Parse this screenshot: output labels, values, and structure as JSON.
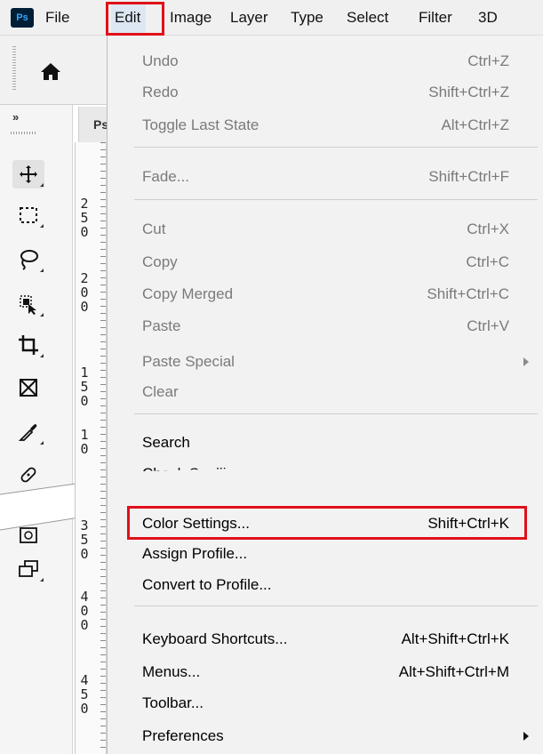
{
  "app": {
    "logo_text": "Ps"
  },
  "menubar": {
    "items": [
      "File",
      "Edit",
      "Image",
      "Layer",
      "Type",
      "Select",
      "Filter",
      "3D"
    ]
  },
  "document_tab": {
    "label": "Ps"
  },
  "toolbar": {
    "tools": [
      "home-icon",
      "move-icon",
      "marquee-icon",
      "lasso-icon",
      "object-select-icon",
      "crop-icon",
      "frame-icon",
      "eyedropper-icon",
      "healing-icon",
      "quick-mask-icon",
      "screen-mode-icon"
    ]
  },
  "ruler": {
    "labels": [
      [
        "2",
        "5",
        "0"
      ],
      [
        "2",
        "0",
        "0"
      ],
      [
        "1",
        "5",
        "0"
      ],
      [
        "1",
        "0"
      ],
      [
        "3",
        "5",
        "0"
      ],
      [
        "4",
        "0",
        "0"
      ],
      [
        "4",
        "5",
        "0"
      ]
    ]
  },
  "edit_menu": {
    "items": [
      {
        "label": "Undo",
        "shortcut": "Ctrl+Z",
        "enabled": false
      },
      {
        "label": "Redo",
        "shortcut": "Shift+Ctrl+Z",
        "enabled": false
      },
      {
        "label": "Toggle Last State",
        "shortcut": "Alt+Ctrl+Z",
        "enabled": false
      },
      {
        "label": "Fade...",
        "shortcut": "Shift+Ctrl+F",
        "enabled": false
      },
      {
        "label": "Cut",
        "shortcut": "Ctrl+X",
        "enabled": false
      },
      {
        "label": "Copy",
        "shortcut": "Ctrl+C",
        "enabled": false
      },
      {
        "label": "Copy Merged",
        "shortcut": "Shift+Ctrl+C",
        "enabled": false
      },
      {
        "label": "Paste",
        "shortcut": "Ctrl+V",
        "enabled": false
      },
      {
        "label": "Paste Special",
        "shortcut": "",
        "enabled": false,
        "submenu": true
      },
      {
        "label": "Clear",
        "shortcut": "",
        "enabled": false
      },
      {
        "label": "Search",
        "shortcut": "",
        "enabled": true
      },
      {
        "label": "Check Spelling...",
        "shortcut": "",
        "enabled": true
      },
      {
        "label": "Color Settings...",
        "shortcut": "Shift+Ctrl+K",
        "enabled": true,
        "highlighted": true
      },
      {
        "label": "Assign Profile...",
        "shortcut": "",
        "enabled": true
      },
      {
        "label": "Convert to Profile...",
        "shortcut": "",
        "enabled": true
      },
      {
        "label": "Keyboard Shortcuts...",
        "shortcut": "Alt+Shift+Ctrl+K",
        "enabled": true
      },
      {
        "label": "Menus...",
        "shortcut": "Alt+Shift+Ctrl+M",
        "enabled": true
      },
      {
        "label": "Toolbar...",
        "shortcut": "",
        "enabled": true
      },
      {
        "label": "Preferences",
        "shortcut": "",
        "enabled": true,
        "submenu": true
      }
    ]
  },
  "colors": {
    "highlight_box": "#e0101a",
    "active_menu_bg": "#dde7f3",
    "logo_bg": "#001e36",
    "logo_fg": "#31a8ff"
  }
}
